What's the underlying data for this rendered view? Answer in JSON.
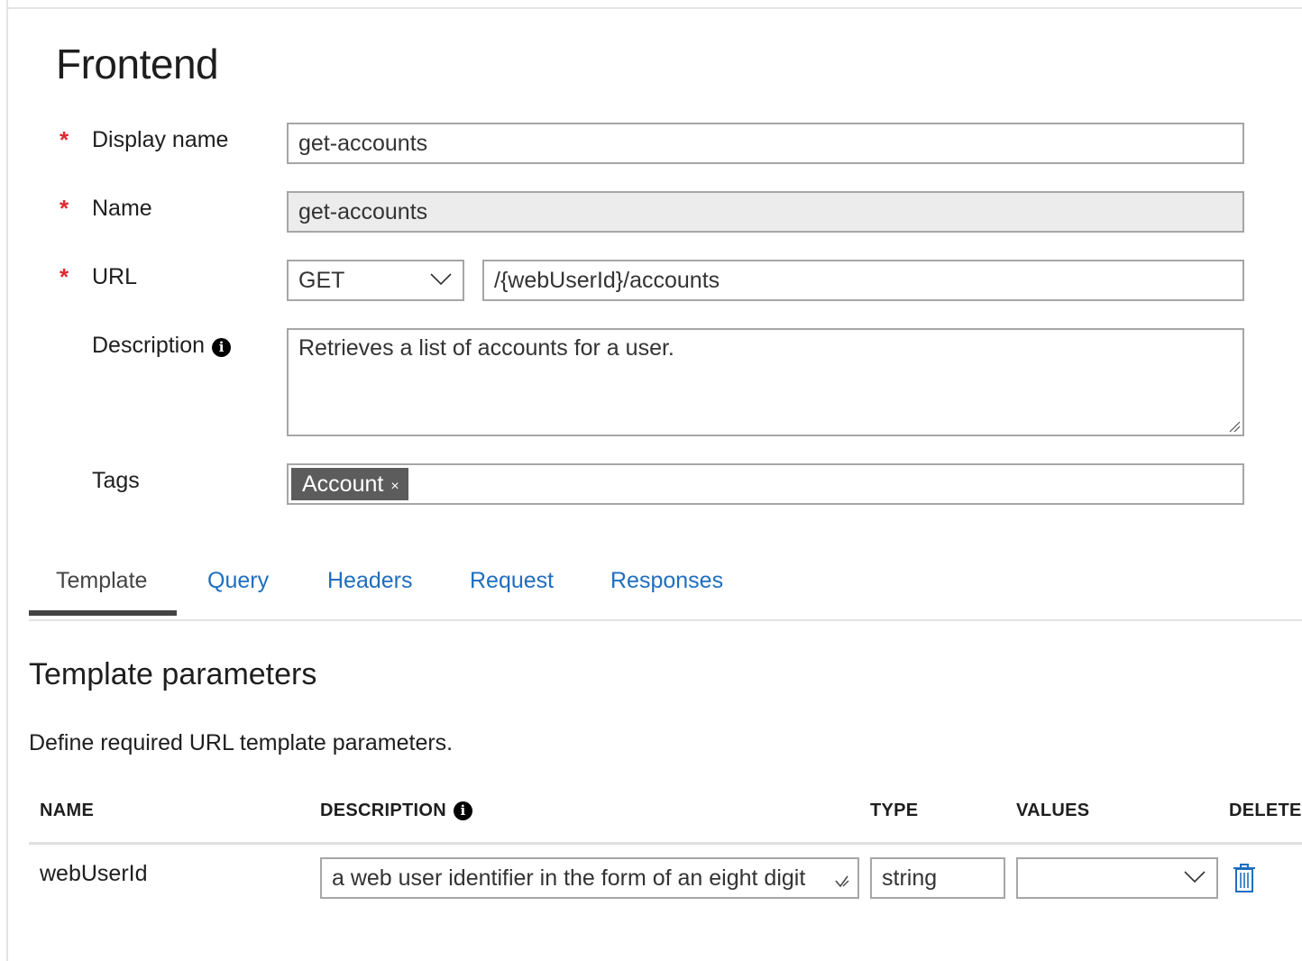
{
  "page": {
    "title": "Frontend"
  },
  "form": {
    "display_name": {
      "label": "Display name",
      "required_mark": "*",
      "value": "get-accounts"
    },
    "name": {
      "label": "Name",
      "required_mark": "*",
      "value": "get-accounts"
    },
    "url": {
      "label": "URL",
      "required_mark": "*",
      "method": "GET",
      "path": "/{webUserId}/accounts"
    },
    "description": {
      "label": "Description",
      "info_icon": "i",
      "value": "Retrieves a list of accounts for a user."
    },
    "tags": {
      "label": "Tags",
      "items": [
        {
          "label": "Account",
          "remove": "×"
        }
      ]
    }
  },
  "tabs": [
    {
      "label": "Template",
      "active": true
    },
    {
      "label": "Query",
      "active": false
    },
    {
      "label": "Headers",
      "active": false
    },
    {
      "label": "Request",
      "active": false
    },
    {
      "label": "Responses",
      "active": false
    }
  ],
  "template_params": {
    "title": "Template parameters",
    "subtitle": "Define required URL template parameters.",
    "columns": {
      "name": "NAME",
      "description": "DESCRIPTION",
      "description_info_icon": "i",
      "type": "TYPE",
      "values": "VALUES",
      "delete": "DELETE"
    },
    "rows": [
      {
        "name": "webUserId",
        "description": "a web user identifier in the form of an eight digit",
        "type": "string",
        "values": ""
      }
    ]
  },
  "colors": {
    "accent_link": "#1f6ebf",
    "required": "#e0282e",
    "tag_chip": "#5c5c5c"
  },
  "icons": [
    "info-icon",
    "chevron-down-icon",
    "close-icon",
    "resize-grip-icon",
    "trash-icon"
  ]
}
